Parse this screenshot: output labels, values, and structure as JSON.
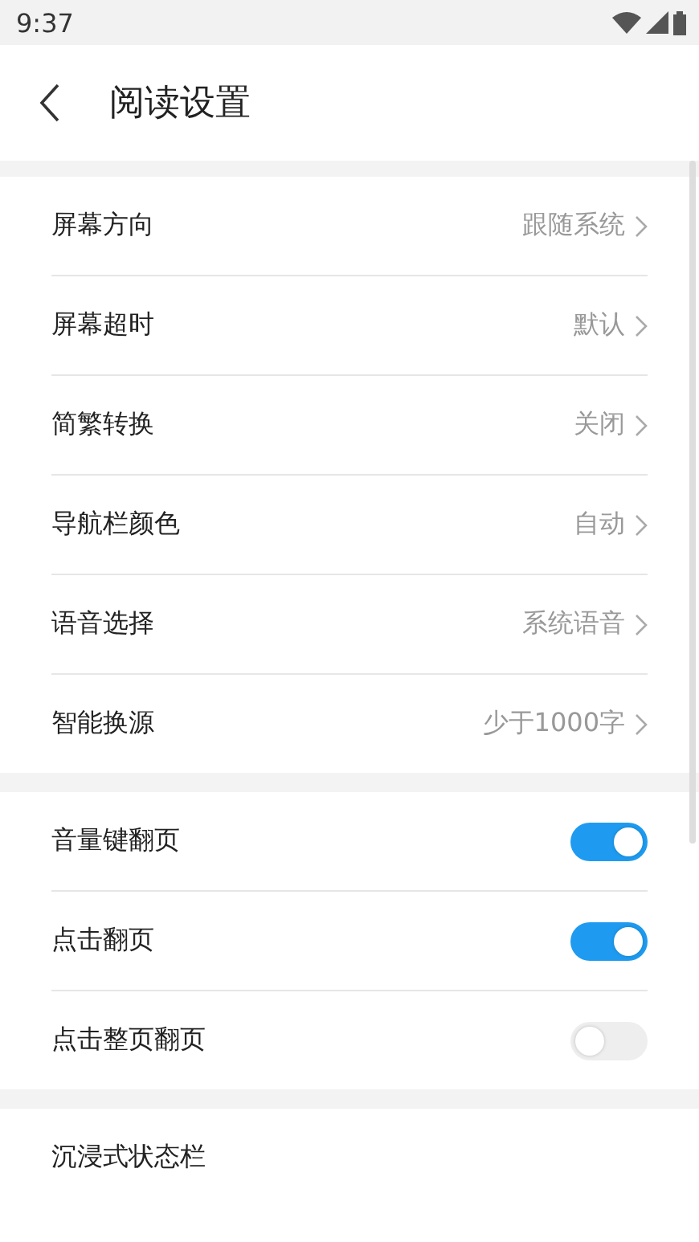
{
  "status_bar": {
    "time": "9:37"
  },
  "header": {
    "title": "阅读设置"
  },
  "sections": [
    {
      "rows": [
        {
          "kind": "link",
          "label": "屏幕方向",
          "value": "跟随系统"
        },
        {
          "kind": "link",
          "label": "屏幕超时",
          "value": "默认"
        },
        {
          "kind": "link",
          "label": "简繁转换",
          "value": "关闭"
        },
        {
          "kind": "link",
          "label": "导航栏颜色",
          "value": "自动"
        },
        {
          "kind": "link",
          "label": "语音选择",
          "value": "系统语音"
        },
        {
          "kind": "link",
          "label": "智能换源",
          "value": "少于1000字"
        }
      ]
    },
    {
      "rows": [
        {
          "kind": "toggle",
          "label": "音量键翻页",
          "on": true
        },
        {
          "kind": "toggle",
          "label": "点击翻页",
          "on": true
        },
        {
          "kind": "toggle",
          "label": "点击整页翻页",
          "on": false
        }
      ]
    },
    {
      "rows": [
        {
          "kind": "plain",
          "label": "沉浸式状态栏"
        }
      ]
    }
  ]
}
